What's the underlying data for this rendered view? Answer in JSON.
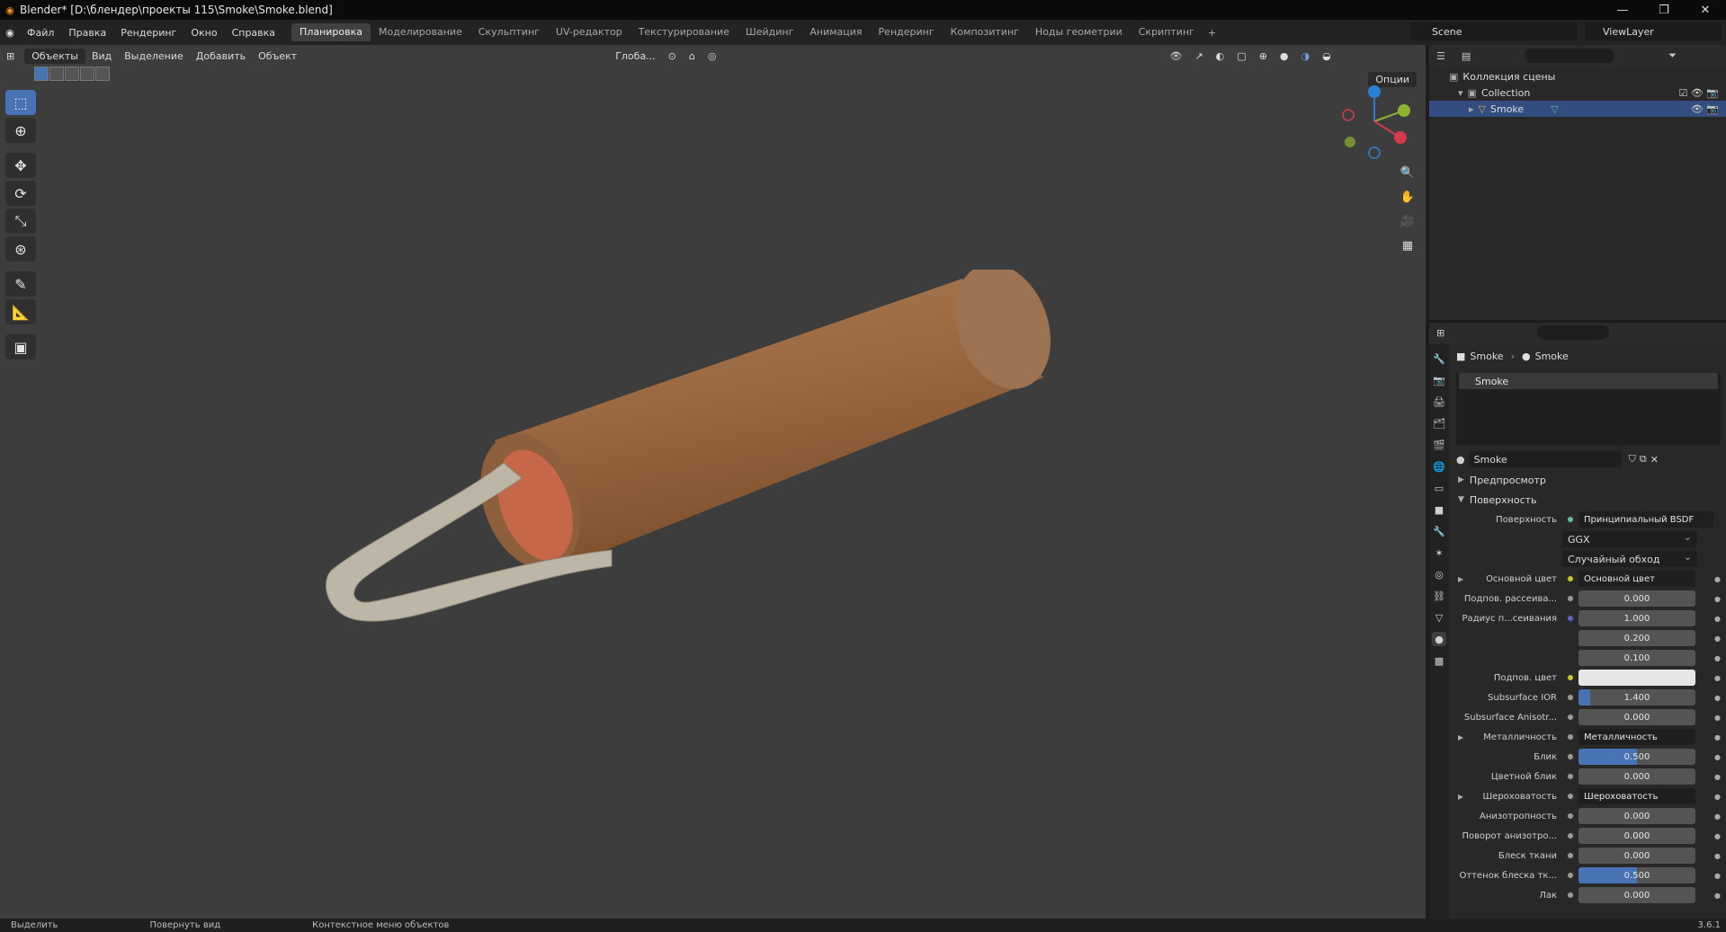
{
  "window": {
    "title": "Blender* [D:\\блендер\\проекты 115\\Smoke\\Smoke.blend]",
    "controls": [
      "—",
      "❐",
      "✕"
    ]
  },
  "menu": [
    "Файл",
    "Правка",
    "Рендеринг",
    "Окно",
    "Справка"
  ],
  "workspaces": [
    {
      "label": "Планировка",
      "active": true
    },
    {
      "label": "Моделирование"
    },
    {
      "label": "Скульптинг"
    },
    {
      "label": "UV-редактор"
    },
    {
      "label": "Текстурирование"
    },
    {
      "label": "Шейдинг"
    },
    {
      "label": "Анимация"
    },
    {
      "label": "Рендеринг"
    },
    {
      "label": "Композитинг"
    },
    {
      "label": "Ноды геометрии"
    },
    {
      "label": "Скриптинг"
    }
  ],
  "scene": "Scene",
  "viewlayer": "ViewLayer",
  "viewport": {
    "mode": "Объекты",
    "menu": [
      "Вид",
      "Выделение",
      "Добавить",
      "Объект"
    ],
    "transform": "Глоба...",
    "options": "Опции"
  },
  "outliner": {
    "root": "Коллекция сцены",
    "collection": "Collection",
    "object": "Smoke"
  },
  "properties": {
    "crumb_object": "Smoke",
    "crumb_material": "Smoke",
    "slot": "Smoke",
    "material_name": "Smoke",
    "panel_preview": "Предпросмотр",
    "panel_surface": "Поверхность",
    "surface_label": "Поверхность",
    "surface_value": "Принципиальный BSDF",
    "dist1": "GGX",
    "dist2": "Случайный обход",
    "rows": [
      {
        "label": "Основной цвет",
        "value": "Основной цвет",
        "type": "link",
        "sock": "yellow",
        "exp": true
      },
      {
        "label": "Подпов. рассеива...",
        "value": "0.000",
        "type": "num",
        "sock": "grey"
      },
      {
        "label": "Радиус п...сеивания",
        "value": "1.000",
        "type": "num",
        "sock": "blue"
      },
      {
        "label": "",
        "value": "0.200",
        "type": "num"
      },
      {
        "label": "",
        "value": "0.100",
        "type": "num"
      },
      {
        "label": "Подпов. цвет",
        "value": "",
        "type": "white",
        "sock": "yellow"
      },
      {
        "label": "Subsurface IOR",
        "value": "1.400",
        "type": "num",
        "sock": "grey",
        "fill": 0.1
      },
      {
        "label": "Subsurface Anisotr...",
        "value": "0.000",
        "type": "num",
        "sock": "grey"
      },
      {
        "label": "Металличность",
        "value": "Металличность",
        "type": "link",
        "sock": "grey",
        "exp": true
      },
      {
        "label": "Блик",
        "value": "0.500",
        "type": "num",
        "sock": "grey",
        "fill": 0.5
      },
      {
        "label": "Цветной блик",
        "value": "0.000",
        "type": "num",
        "sock": "grey"
      },
      {
        "label": "Шероховатость",
        "value": "Шероховатость",
        "type": "link",
        "sock": "grey",
        "exp": true
      },
      {
        "label": "Анизотропность",
        "value": "0.000",
        "type": "num",
        "sock": "grey"
      },
      {
        "label": "Поворот анизотро...",
        "value": "0.000",
        "type": "num",
        "sock": "grey"
      },
      {
        "label": "Блеск ткани",
        "value": "0.000",
        "type": "num",
        "sock": "grey"
      },
      {
        "label": "Оттенок блеска тк...",
        "value": "0.500",
        "type": "num",
        "sock": "grey",
        "fill": 0.5
      },
      {
        "label": "Лак",
        "value": "0.000",
        "type": "num",
        "sock": "grey"
      }
    ]
  },
  "status": {
    "select": "Выделить",
    "rotate": "Повернуть вид",
    "context": "Контекстное меню объектов",
    "version": "3.6.1"
  },
  "colors": {
    "accent": "#4772b3",
    "viewport_bg": "#3d3d3d",
    "tube": "#9c6a42",
    "strap": "#bdb6a6"
  }
}
